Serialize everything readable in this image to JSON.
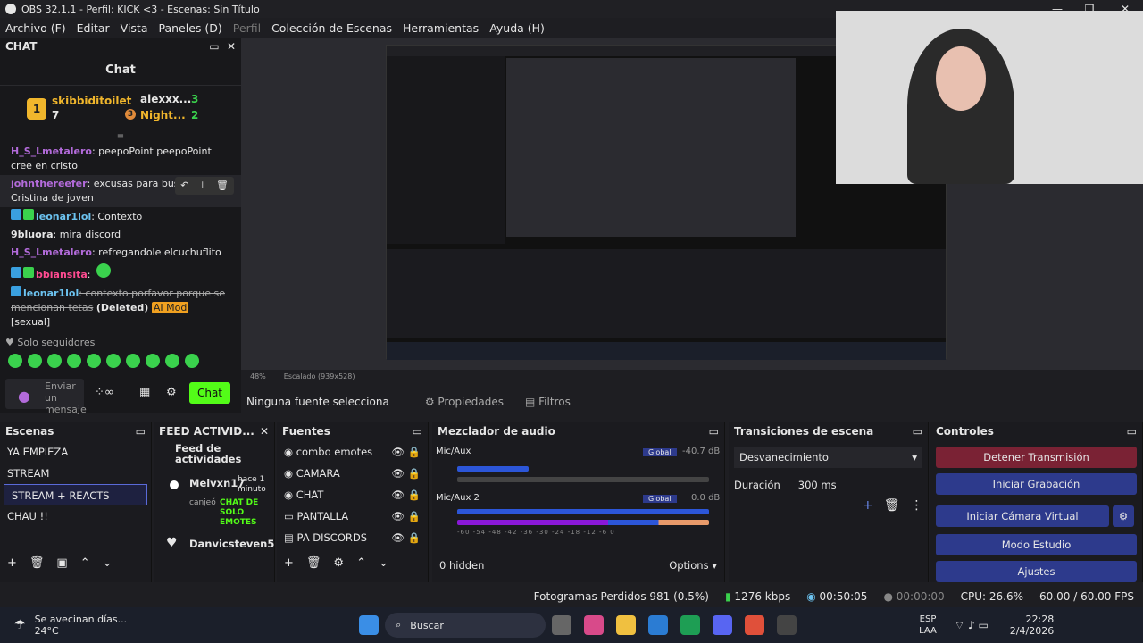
{
  "titlebar": {
    "title": "OBS 32.1.1 - Perfil: KICK <3 - Escenas: Sin Título"
  },
  "menu": [
    "Archivo (F)",
    "Editar",
    "Vista",
    "Paneles (D)",
    "Perfil",
    "Colección de Escenas",
    "Herramientas",
    "Ayuda (H)"
  ],
  "chat": {
    "dock_title": "CHAT",
    "header": "Chat",
    "leaders": {
      "first_name": "skibbiditoilet",
      "first_rank": "1",
      "first_count": "7",
      "second_name": "alexxx...",
      "second_count": "3",
      "third_name": "Night...",
      "third_rank": "3",
      "third_count": "2"
    },
    "messages": [
      {
        "user": "H_S_Lmetalero",
        "text": ": peepoPoint peepoPoint cree en cristo"
      },
      {
        "user": "johnthereefer",
        "text": ": excusas para busc... Cristina de joven"
      },
      {
        "user": "leonar1lol",
        "text": ": Contexto"
      },
      {
        "user": "9bluora",
        "text": ": mira discord"
      },
      {
        "user": "H_S_Lmetalero",
        "text": ": refregandole elcuchuflito"
      },
      {
        "user": "bbiansita",
        "text": ":"
      },
      {
        "user": "leonar1lol",
        "text": ": contexto porfavor porque se mencionan tetas",
        "deleted": "(Deleted)",
        "tag": "AI Mod",
        "tag2": "[sexual]"
      }
    ],
    "followers_only": "Solo seguidores",
    "send_placeholder": "Enviar un mensaje",
    "chat_button": "Chat"
  },
  "context": {
    "no_source": "Ninguna fuente selecciona",
    "properties": "Propiedades",
    "filters": "Filtros"
  },
  "preview_bar": {
    "zoom": "48%",
    "scale": "Escalado (939x528)"
  },
  "scenes": {
    "title": "Escenas",
    "items": [
      "YA EMPIEZA",
      "STREAM",
      "STREAM + REACTS",
      "CHAU !!"
    ]
  },
  "feed": {
    "title": "FEED ACTIVID...",
    "heading": "Feed de actividades",
    "user1": "Melvxn17",
    "time1": "hace 1 minuto",
    "action1": "canjeó",
    "reward1": "CHAT DE SOLO EMOTES",
    "user2": "Danvicsteven5"
  },
  "sources": {
    "title": "Fuentes",
    "items": [
      "combo emotes",
      "CAMARA",
      "CHAT",
      "PANTALLA",
      "PA DISCORDS"
    ]
  },
  "mixer": {
    "title": "Mezclador de audio",
    "ticks": [
      "-60",
      "-54",
      "-48",
      "-42",
      "-36",
      "-30",
      "-24",
      "-18",
      "-12",
      "-6",
      "0"
    ],
    "ch1": {
      "name": "Mic/Aux",
      "tag": "Global",
      "db": "-40.7 dB"
    },
    "ch2": {
      "name": "Mic/Aux 2",
      "tag": "Global",
      "db": "0.0 dB"
    },
    "hidden": "0 hidden",
    "options": "Options"
  },
  "transitions": {
    "title": "Transiciones de escena",
    "type": "Desvanecimiento",
    "duration_label": "Duración",
    "duration": "300 ms"
  },
  "controls": {
    "title": "Controles",
    "stop": "Detener Transmisión",
    "record": "Iniciar Grabación",
    "vcam": "Iniciar Cámara Virtual",
    "studio": "Modo Estudio",
    "settings": "Ajustes"
  },
  "status": {
    "dropped": "Fotogramas Perdidos 981 (0.5%)",
    "kbps": "1276 kbps",
    "live": "00:50:05",
    "rec": "00:00:00",
    "cpu": "CPU: 26.6%",
    "fps": "60.00 / 60.00 FPS"
  },
  "taskbar": {
    "weather": "Se avecinan días...",
    "temp": "24°C",
    "search": "Buscar",
    "lang1": "ESP",
    "lang2": "LAA",
    "time": "22:28",
    "date": "2/4/2026"
  }
}
